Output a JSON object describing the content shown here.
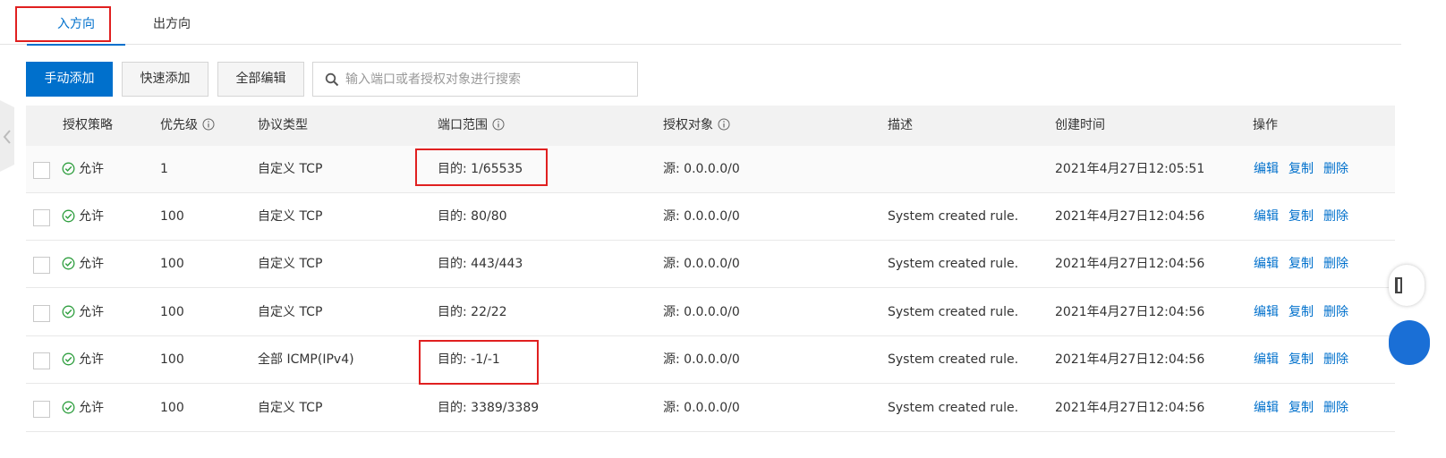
{
  "tabs": {
    "inbound": "入方向",
    "outbound": "出方向"
  },
  "toolbar": {
    "manual_add": "手动添加",
    "quick_add": "快速添加",
    "edit_all": "全部编辑",
    "search_placeholder": "输入端口或者授权对象进行搜索"
  },
  "table": {
    "headers": {
      "policy": "授权策略",
      "priority": "优先级",
      "protocol": "协议类型",
      "port_range": "端口范围",
      "auth_object": "授权对象",
      "description": "描述",
      "created": "创建时间",
      "actions": "操作"
    },
    "rows": [
      {
        "policy": "允许",
        "priority": "1",
        "protocol": "自定义 TCP",
        "port": "目的: 1/65535",
        "auth": "源: 0.0.0.0/0",
        "desc": "",
        "created": "2021年4月27日12:05:51"
      },
      {
        "policy": "允许",
        "priority": "100",
        "protocol": "自定义 TCP",
        "port": "目的: 80/80",
        "auth": "源: 0.0.0.0/0",
        "desc": "System created rule.",
        "created": "2021年4月27日12:04:56"
      },
      {
        "policy": "允许",
        "priority": "100",
        "protocol": "自定义 TCP",
        "port": "目的: 443/443",
        "auth": "源: 0.0.0.0/0",
        "desc": "System created rule.",
        "created": "2021年4月27日12:04:56"
      },
      {
        "policy": "允许",
        "priority": "100",
        "protocol": "自定义 TCP",
        "port": "目的: 22/22",
        "auth": "源: 0.0.0.0/0",
        "desc": "System created rule.",
        "created": "2021年4月27日12:04:56"
      },
      {
        "policy": "允许",
        "priority": "100",
        "protocol": "全部 ICMP(IPv4)",
        "port": "目的: -1/-1",
        "auth": "源: 0.0.0.0/0",
        "desc": "System created rule.",
        "created": "2021年4月27日12:04:56"
      },
      {
        "policy": "允许",
        "priority": "100",
        "protocol": "自定义 TCP",
        "port": "目的: 3389/3389",
        "auth": "源: 0.0.0.0/0",
        "desc": "System created rule.",
        "created": "2021年4月27日12:04:56"
      }
    ],
    "row_actions": {
      "edit": "编辑",
      "copy": "复制",
      "delete": "删除"
    }
  },
  "colors": {
    "primary": "#0070cc",
    "allow_green": "#2e9e3e",
    "highlight_red": "#e02020",
    "header_bg": "#f2f2f2"
  }
}
